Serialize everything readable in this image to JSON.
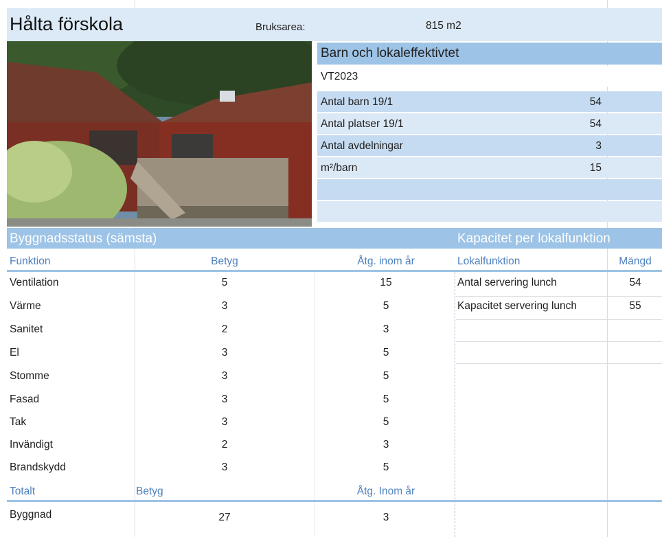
{
  "header": {
    "title": "Hålta förskola",
    "area_label": "Bruksarea:",
    "area_value": "815 m2"
  },
  "kpi": {
    "heading": "Barn och lokaleffektivtet",
    "period": "VT2023",
    "rows": [
      {
        "label": "Antal barn 19/1",
        "value": "54"
      },
      {
        "label": "Antal platser 19/1",
        "value": "54"
      },
      {
        "label": "Antal avdelningar",
        "value": "3"
      },
      {
        "label": "m²/barn",
        "value": "15"
      }
    ]
  },
  "building_status": {
    "heading": "Byggnadsstatus (sämsta)",
    "columns": [
      "Funktion",
      "Betyg",
      "Åtg. inom år"
    ],
    "rows": [
      {
        "funktion": "Ventilation",
        "betyg": "5",
        "atg": "15"
      },
      {
        "funktion": "Värme",
        "betyg": "3",
        "atg": "5"
      },
      {
        "funktion": "Sanitet",
        "betyg": "2",
        "atg": "3"
      },
      {
        "funktion": "El",
        "betyg": "3",
        "atg": "5"
      },
      {
        "funktion": "Stomme",
        "betyg": "3",
        "atg": "5"
      },
      {
        "funktion": "Fasad",
        "betyg": "3",
        "atg": "5"
      },
      {
        "funktion": "Tak",
        "betyg": "3",
        "atg": "5"
      },
      {
        "funktion": "Invändigt",
        "betyg": "2",
        "atg": "3"
      },
      {
        "funktion": "Brandskydd",
        "betyg": "3",
        "atg": "5"
      }
    ],
    "total_columns": [
      "Totalt",
      "Betyg",
      "Åtg. Inom år"
    ],
    "total_row": {
      "funktion": "Byggnad",
      "betyg": "27",
      "atg": "3"
    }
  },
  "capacity": {
    "heading": "Kapacitet per lokalfunktion",
    "columns": [
      "Lokalfunktion",
      "Mängd"
    ],
    "rows": [
      {
        "funktion": "Antal servering lunch",
        "mangd": "54"
      },
      {
        "funktion": "Kapacitet servering lunch",
        "mangd": "55"
      }
    ]
  },
  "photo": {
    "icon": "building-photo",
    "colors": {
      "sky": "#6f8fa8",
      "trees": "#2f4a26",
      "roof": "#6e3b2c",
      "wall": "#7a2f24",
      "deck": "#9b8f7d",
      "bush": "#9fb870"
    }
  }
}
